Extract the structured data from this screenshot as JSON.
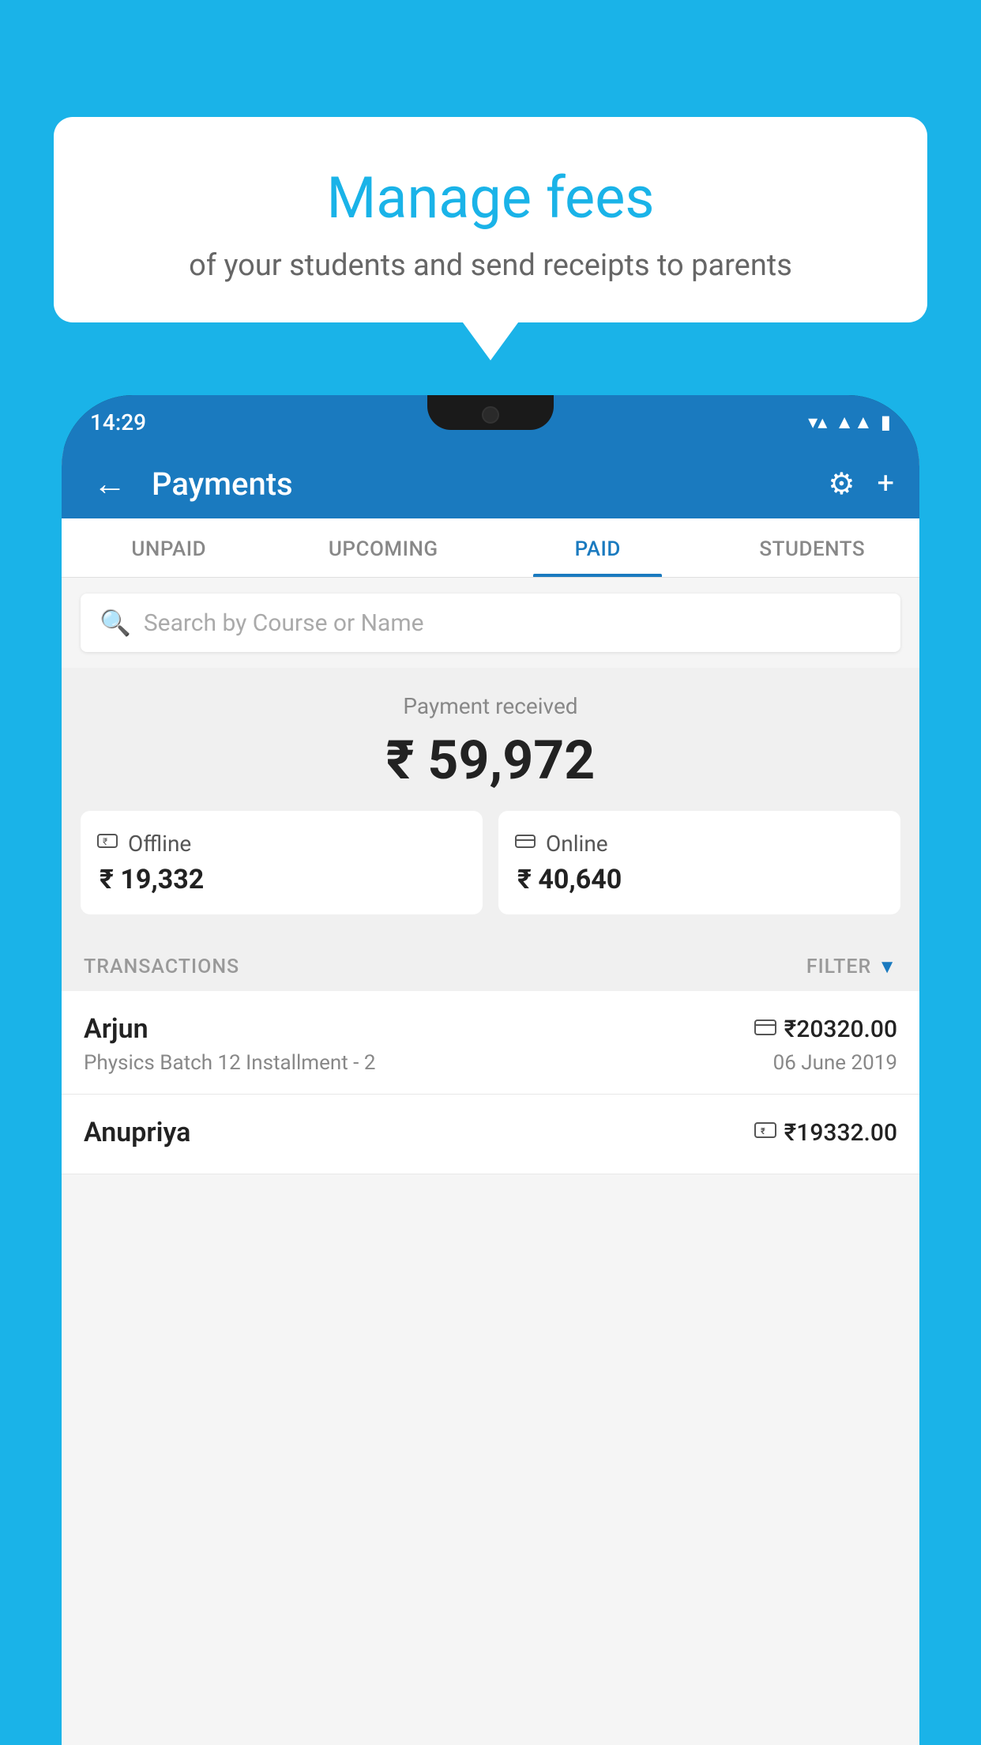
{
  "background_color": "#1ab3e8",
  "speech_bubble": {
    "title": "Manage fees",
    "subtitle": "of your students and send receipts to parents"
  },
  "status_bar": {
    "time": "14:29",
    "wifi_icon": "▼▲",
    "signal_icon": "▲▲",
    "battery_icon": "▮"
  },
  "top_bar": {
    "title": "Payments",
    "back_label": "←",
    "gear_label": "⚙",
    "plus_label": "+"
  },
  "tabs": [
    {
      "label": "UNPAID",
      "active": false
    },
    {
      "label": "UPCOMING",
      "active": false
    },
    {
      "label": "PAID",
      "active": true
    },
    {
      "label": "STUDENTS",
      "active": false
    }
  ],
  "search": {
    "placeholder": "Search by Course or Name"
  },
  "payment_summary": {
    "received_label": "Payment received",
    "total_amount": "₹ 59,972",
    "offline": {
      "label": "Offline",
      "amount": "₹ 19,332"
    },
    "online": {
      "label": "Online",
      "amount": "₹ 40,640"
    }
  },
  "transactions": {
    "section_label": "TRANSACTIONS",
    "filter_label": "FILTER",
    "items": [
      {
        "name": "Arjun",
        "detail": "Physics Batch 12 Installment - 2",
        "amount": "₹20320.00",
        "date": "06 June 2019",
        "payment_type": "card"
      },
      {
        "name": "Anupriya",
        "detail": "",
        "amount": "₹19332.00",
        "date": "",
        "payment_type": "cash"
      }
    ]
  }
}
